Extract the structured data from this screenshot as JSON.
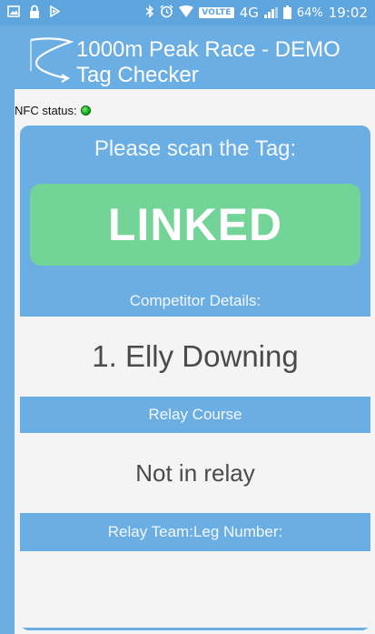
{
  "status_bar": {
    "volte_badge": "VOLTE",
    "network": "4G",
    "battery_percent": "64%",
    "time": "19:02",
    "icons": [
      "image-icon",
      "lock-icon",
      "play-arrow-icon",
      "bluetooth-icon",
      "alarm-icon",
      "wifi-icon",
      "signal-icon",
      "battery-icon"
    ]
  },
  "header": {
    "title_line1": "1000m Peak Race - DEMO",
    "title_line2": "Tag Checker",
    "logo_icon": "race-logo-icon"
  },
  "nfc": {
    "label": "NFC status:",
    "status_color": "#12b012"
  },
  "scan": {
    "prompt": "Please scan the Tag:",
    "result_label": "LINKED",
    "result_color": "#73d498"
  },
  "competitor": {
    "header": "Competitor Details:",
    "value": "1. Elly Downing"
  },
  "relay_course": {
    "header": "Relay Course",
    "value": "Not in relay"
  },
  "relay_team": {
    "header": "Relay Team:Leg Number:",
    "value": ""
  },
  "colors": {
    "primary": "#6aaee4",
    "status_bar": "#5ea4dd",
    "surface": "#f4f4f4",
    "success": "#73d498"
  }
}
